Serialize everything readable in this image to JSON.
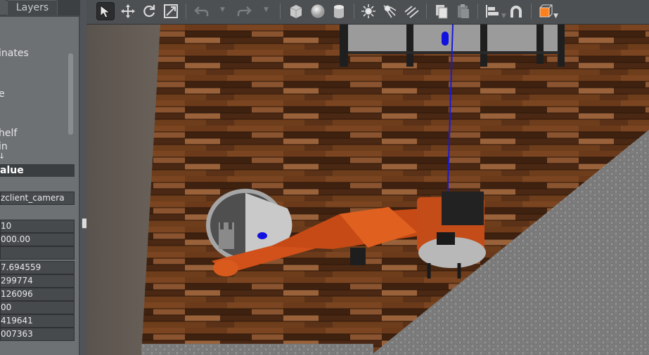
{
  "left_panel": {
    "tabs": {
      "world": "",
      "layers": "Layers"
    },
    "tree": [
      "inates",
      "e",
      "helf",
      "in",
      "↓"
    ],
    "property_header": "alue",
    "properties": [
      "zclient_camera",
      "",
      "10",
      "000.00",
      "",
      "7.694559",
      "299774",
      "126096",
      "00",
      "419641",
      "007363"
    ]
  },
  "toolbar": {
    "tools": [
      "select-mode",
      "translate-mode",
      "rotate-mode",
      "scale-mode",
      "undo",
      "redo",
      "box-shape",
      "sphere-shape",
      "cylinder-shape",
      "point-light",
      "spot-light",
      "directional-light",
      "copy",
      "paste",
      "align",
      "snap",
      "view-angle"
    ],
    "accent": "#ff7f1a"
  },
  "viewport": {
    "scene": "kuka robot arm on wooden floor"
  }
}
